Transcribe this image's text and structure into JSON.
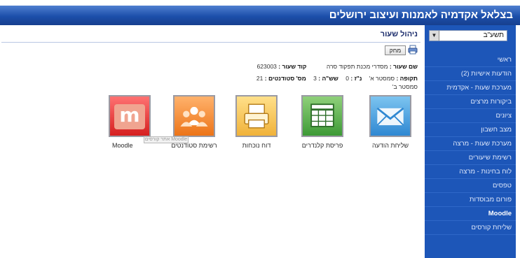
{
  "window": {
    "title": "בצלאל אקדמיה לאמנות ועיצוב ירושלים"
  },
  "sidebar": {
    "semester_value": "תשע\"ב",
    "items": [
      "ראשי",
      "הודעות אישיות (2)",
      "מערכת שעות - אקדמית",
      "ביקורות מרצים",
      "ציונים",
      "מצב חשבון",
      "מערכת שעות - מרצה",
      "רשימת שיעורים",
      "לוח בחינות - מרצה",
      "טפסים",
      "פורום מבוסדות",
      "Moodle",
      "שליחת קורסים"
    ]
  },
  "page": {
    "title": "ניהול שעור",
    "delete_label": "מחק",
    "course_name_label": "שם שעור :",
    "course_name_value": "מסדרי מכנת תפקוד סרה",
    "course_code_label": "קוד שעור :",
    "course_code_value": "623003",
    "period_label": "תקופה :",
    "period_value": "סמסטר א'",
    "day_label": "נ\"ז :",
    "day_value": "0",
    "hours_label": "שש\"ה :",
    "hours_value": "3",
    "students_label": "מס' סטודנטים :",
    "students_value": "21",
    "sem_b": "סמסטר ב'"
  },
  "tiles": [
    {
      "label": "שליחת הודעה",
      "icon": "envelope-icon"
    },
    {
      "label": "פריסת קלנדרים",
      "icon": "calendar-icon"
    },
    {
      "label": "דוח נוכחות",
      "icon": "printer-icon"
    },
    {
      "label": "רשימת סטודנטים",
      "icon": "group-icon"
    },
    {
      "label": "Moodle",
      "icon": "moodle-icon"
    }
  ],
  "tooltip": "אתר קורסים Moodle",
  "colors": {
    "sidebar": "#1d56b8",
    "topbar": "#1c4faa",
    "title": "#1a2b6b"
  }
}
